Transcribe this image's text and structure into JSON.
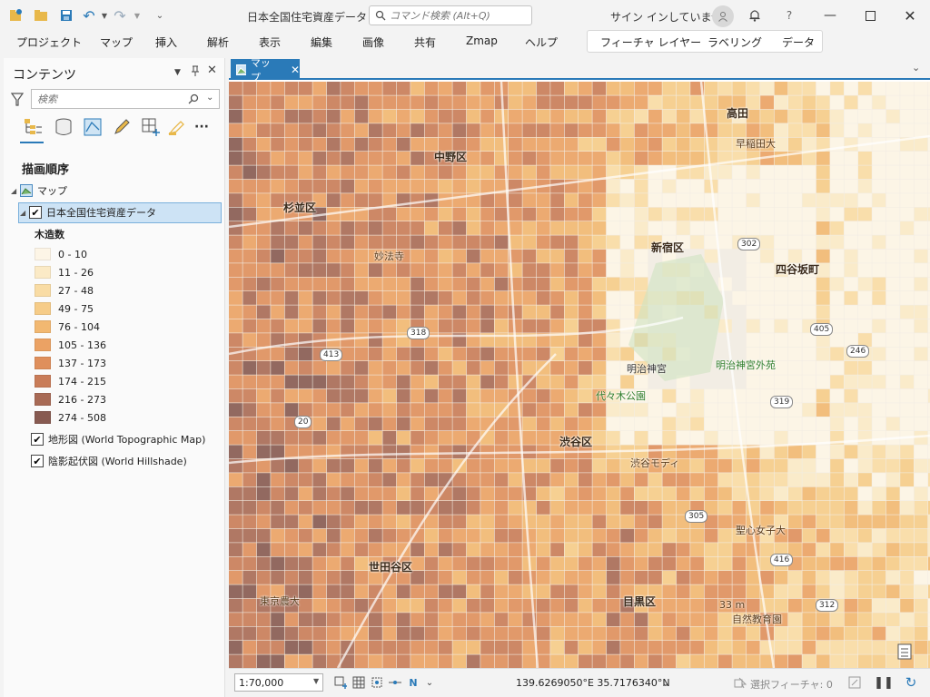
{
  "app": {
    "title": "日本全国住宅資産データ",
    "command_search_placeholder": "コマンド検索 (Alt+Q)",
    "sign_in": "サイン インしていません",
    "help": "?"
  },
  "menu": [
    "プロジェクト",
    "マップ",
    "挿入",
    "解析",
    "表示",
    "編集",
    "画像",
    "共有",
    "Zmap",
    "ヘルプ"
  ],
  "context_tabs": [
    "フィーチャ レイヤー",
    "ラベリング",
    "データ"
  ],
  "contents": {
    "title": "コンテンツ",
    "search_placeholder": "検索",
    "draw_order": "描画順序",
    "map_name": "マップ",
    "layer_name": "日本全国住宅資産データ",
    "field_name": "木造数",
    "legend": [
      {
        "label": "0 - 10",
        "color": "#fdf5e6"
      },
      {
        "label": "11 - 26",
        "color": "#fbeac6"
      },
      {
        "label": "27 - 48",
        "color": "#f9dca4"
      },
      {
        "label": "49 - 75",
        "color": "#f6cc88"
      },
      {
        "label": "76 - 104",
        "color": "#f2b871"
      },
      {
        "label": "105 - 136",
        "color": "#eba264"
      },
      {
        "label": "137 - 173",
        "color": "#df8f5c"
      },
      {
        "label": "174 - 215",
        "color": "#c97c58"
      },
      {
        "label": "216 - 273",
        "color": "#a86a55"
      },
      {
        "label": "274 - 508",
        "color": "#875a51"
      }
    ],
    "basemaps": [
      "地形図 (World Topographic Map)",
      "陰影起伏図 (World Hillshade)"
    ]
  },
  "map": {
    "tab_label": "マップ",
    "labels": {
      "nakano": "中野区",
      "suginami": "杉並区",
      "shinjuku": "新宿区",
      "shibuya": "渋谷区",
      "setagaya": "世田谷区",
      "meguro": "目黒区",
      "takada": "高田",
      "yotsuya": "四谷坂町",
      "meiji": "明治神宮",
      "meiji_gaien": "明治神宮外苑",
      "yoyogi": "代々木公園",
      "myohoji": "妙法寺",
      "waseda": "早稲田大",
      "tokyo_univ": "東京農大",
      "seishin": "聖心女子大",
      "shizen": "自然教育園",
      "shibuya_modi": "渋谷モディ",
      "elev": "33 m"
    },
    "route_numbers": [
      "302",
      "413",
      "318",
      "20",
      "405",
      "246",
      "319",
      "305",
      "416",
      "312"
    ]
  },
  "status": {
    "scale": "1:70,000",
    "coordinates": "139.6269050°E 35.7176340°N",
    "selected_features": "選択フィーチャ: 0"
  }
}
